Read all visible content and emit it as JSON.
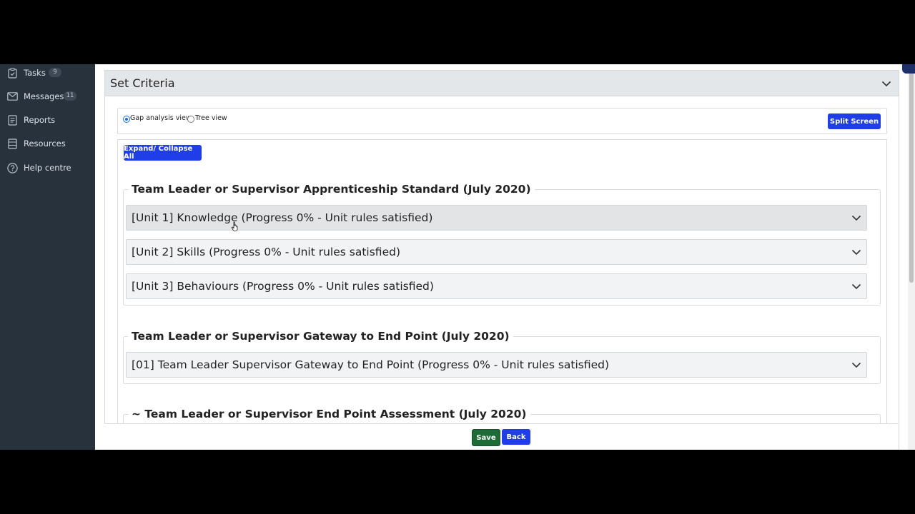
{
  "sidebar": {
    "items": [
      {
        "label": "Tasks",
        "badge": "9",
        "icon": "clipboard-icon"
      },
      {
        "label": "Messages",
        "badge": "11",
        "icon": "envelope-icon"
      },
      {
        "label": "Reports",
        "icon": "report-icon"
      },
      {
        "label": "Resources",
        "icon": "resources-icon"
      },
      {
        "label": "Help centre",
        "icon": "help-icon"
      }
    ]
  },
  "panel": {
    "title": "Set Criteria"
  },
  "view_options": {
    "gap_analysis_label": "Gap analysis view",
    "tree_label": "Tree view",
    "selected": "Gap analysis view",
    "split_screen_label": "Split Screen"
  },
  "expand_collapse_label": "Expand/ Collapse All",
  "groups": [
    {
      "title": "Team Leader or Supervisor Apprenticeship Standard (July 2020)",
      "units": [
        "[Unit 1] Knowledge (Progress 0% - Unit rules satisfied)",
        "[Unit 2] Skills (Progress 0% - Unit rules satisfied)",
        "[Unit 3] Behaviours (Progress 0% - Unit rules satisfied)"
      ]
    },
    {
      "title": "Team Leader or Supervisor Gateway to End Point (July 2020)",
      "units": [
        "[01] Team Leader Supervisor Gateway to End Point (Progress 0% - Unit rules satisfied)"
      ]
    },
    {
      "title": "~ Team Leader or Supervisor End Point Assessment (July 2020)",
      "units": []
    }
  ],
  "footer": {
    "save_label": "Save",
    "back_label": "Back"
  },
  "colors": {
    "primary_button": "#1f3ee8",
    "save_button": "#1e6b38",
    "sidebar_bg": "#28323c"
  }
}
